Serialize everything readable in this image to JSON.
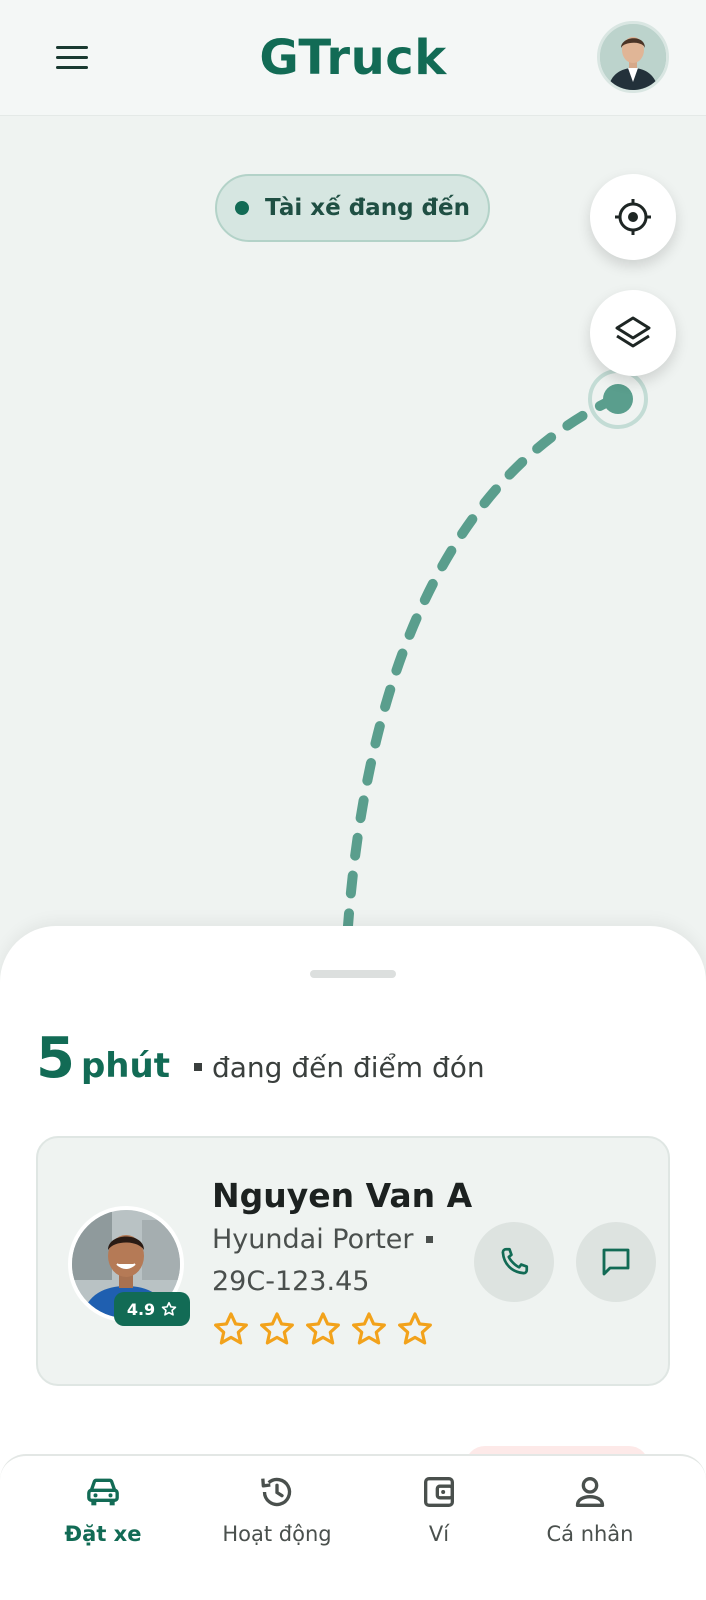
{
  "header": {
    "title": "GTruck"
  },
  "map": {
    "status_label": "Tài xế đang đến"
  },
  "trip": {
    "eta_value": "5",
    "eta_unit": "phút",
    "eta_text": "đang đến điểm đón"
  },
  "driver": {
    "name": "Nguyen Van A",
    "vehicle": "Hyundai Porter",
    "plate": "29C-123.45",
    "rating": "4.9",
    "stars": 5
  },
  "nav": {
    "items": [
      {
        "label": "Đặt xe",
        "icon": "car-icon",
        "active": true
      },
      {
        "label": "Hoạt động",
        "icon": "history-icon",
        "active": false
      },
      {
        "label": "Ví",
        "icon": "wallet-icon",
        "active": false
      },
      {
        "label": "Cá nhân",
        "icon": "person-icon",
        "active": false
      }
    ]
  },
  "colors": {
    "brand": "#126b55",
    "route": "#5a9e8d",
    "star": "#f2a21b",
    "background": "#eff3f1"
  }
}
